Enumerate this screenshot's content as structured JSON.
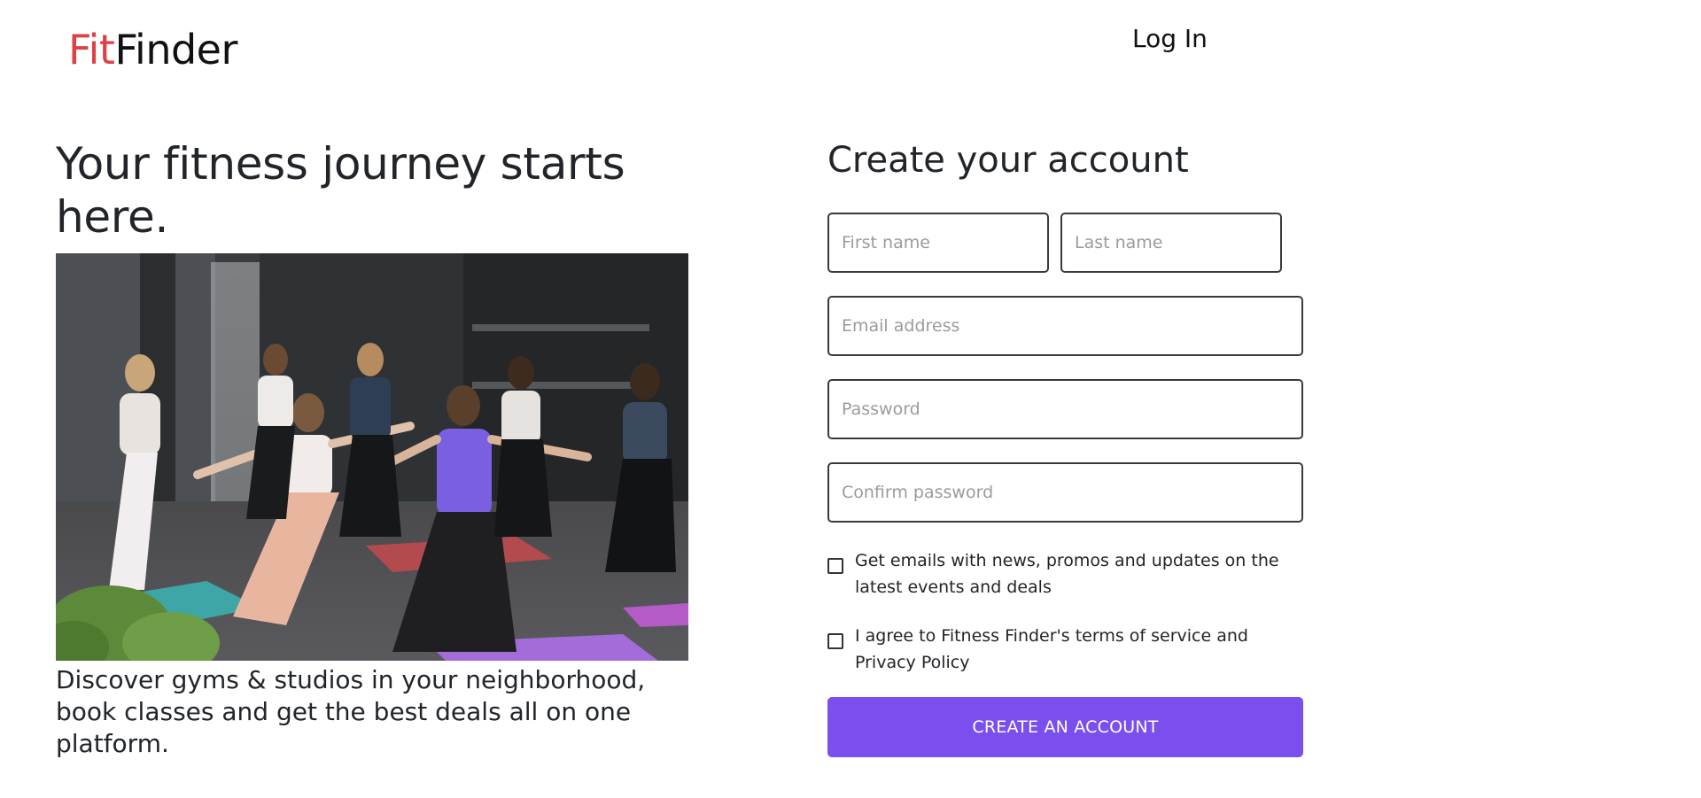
{
  "brand": {
    "part1": "Fit",
    "part2": "Finder",
    "accent_color": "#dc4148"
  },
  "nav": {
    "login_label": "Log In"
  },
  "hero": {
    "title": "Your fitness journey starts here.",
    "image_description": "group-yoga-class-photo",
    "caption": "Discover gyms & studios in your neighborhood, book classes and get the best deals all on one platform."
  },
  "form": {
    "title": "Create your account",
    "first_name_placeholder": "First name",
    "last_name_placeholder": "Last name",
    "email_placeholder": "Email address",
    "password_placeholder": "Password",
    "confirm_password_placeholder": "Confirm password",
    "newsletter_label": "Get emails with news, promos and updates on the latest events and deals",
    "newsletter_checked": false,
    "terms_label": "I agree to Fitness Finder's terms of service and Privacy Policy",
    "terms_checked": false,
    "submit_label": "CREATE AN ACCOUNT",
    "submit_color": "#7a4fed"
  }
}
